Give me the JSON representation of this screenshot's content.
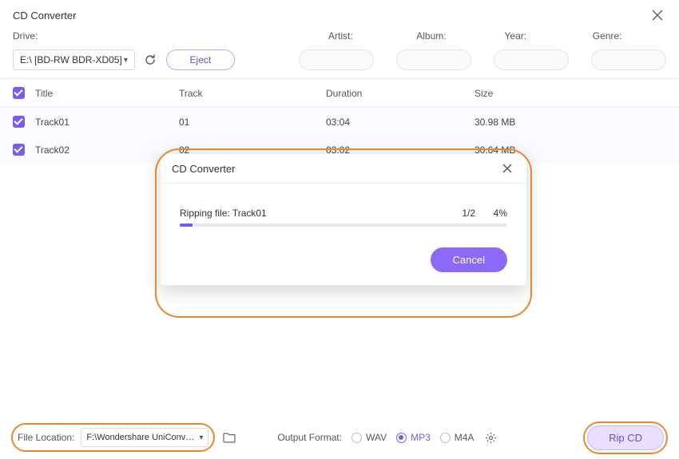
{
  "window": {
    "title": "CD Converter"
  },
  "labels": {
    "drive": "Drive:",
    "artist": "Artist:",
    "album": "Album:",
    "year": "Year:",
    "genre": "Genre:"
  },
  "drive": {
    "selected": "E:\\ [BD-RW  BDR-XD05]"
  },
  "buttons": {
    "eject": "Eject",
    "cancel": "Cancel",
    "rip": "Rip CD"
  },
  "table": {
    "headers": {
      "title": "Title",
      "track": "Track",
      "duration": "Duration",
      "size": "Size"
    },
    "rows": [
      {
        "title": "Track01",
        "track": "01",
        "duration": "03:04",
        "size": "30.98 MB"
      },
      {
        "title": "Track02",
        "track": "02",
        "duration": "03:02",
        "size": "30.64 MB"
      }
    ]
  },
  "modal": {
    "title": "CD Converter",
    "ripping_label": "Ripping file: Track01",
    "count": "1/2",
    "percent": "4%",
    "progress_value": 4
  },
  "footer": {
    "file_location_label": "File Location:",
    "file_location_value": "F:\\Wondershare UniConverter",
    "output_format_label": "Output Format:",
    "formats": {
      "wav": "WAV",
      "mp3": "MP3",
      "m4a": "M4A"
    },
    "selected_format": "mp3"
  },
  "colors": {
    "accent": "#7a5af0",
    "highlight": "#e88a2b"
  }
}
